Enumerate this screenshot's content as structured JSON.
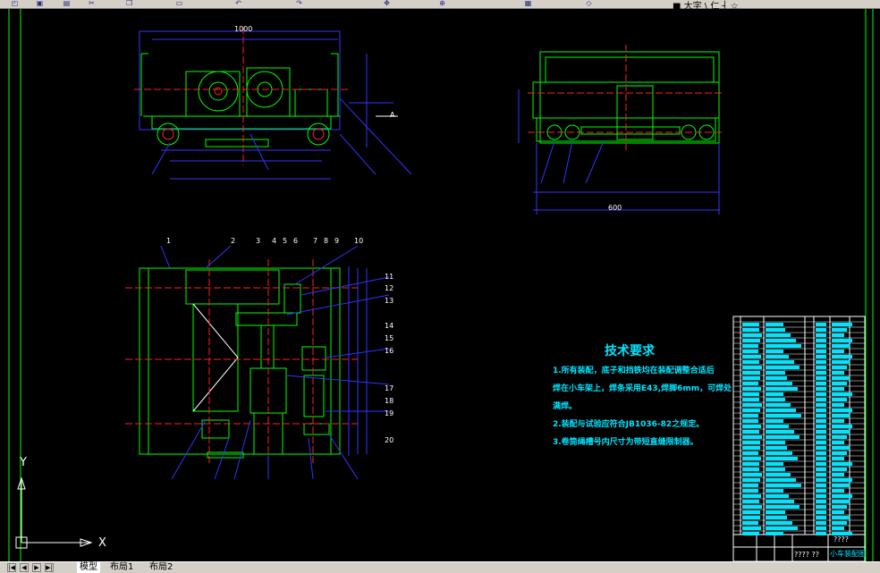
{
  "toolbar": {
    "layer_text": "■ 大字 \\ 仁 ┤ ☆",
    "icons": [
      "open-icon",
      "save-icon",
      "print-icon",
      "cut-icon",
      "copy-icon",
      "paste-icon",
      "undo-icon",
      "redo-icon",
      "pan-icon",
      "zoom-icon",
      "properties-icon",
      "layer-icon"
    ]
  },
  "drawing": {
    "tech_title": "技术要求",
    "tech_lines": [
      "1.所有装配，底子和挡铁均在装配调整合适后",
      "焊在小车架上，焊条采用E43,焊脚6mm，可焊处",
      "满焊。",
      "2.装配与试验应符合JB1036-82之规定。",
      "3.卷筒绳槽号内尺寸为带短直缝限制器。"
    ],
    "title_block": {
      "name": "小车装配图",
      "code": "????",
      "bottom_code": "???? ??"
    },
    "dim_label_plan": "600",
    "dim_label_top": "1000",
    "section_label": "A",
    "part_numbers_top": [
      "1",
      "2",
      "3",
      "4",
      "5",
      "6",
      "7",
      "8",
      "9",
      "10"
    ],
    "part_numbers_right": [
      "11",
      "12",
      "13",
      "14",
      "15",
      "16",
      "17",
      "18",
      "19",
      "20"
    ]
  },
  "ucs": {
    "x_label": "X",
    "y_label": "Y"
  },
  "statusbar": {
    "tabs": [
      "模型",
      "布局1",
      "布局2"
    ],
    "active_tab": 0
  },
  "colors": {
    "background": "#000000",
    "green": "#00ff00",
    "cyan": "#00e5ff",
    "blue": "#3333ff",
    "red": "#ff2020",
    "white": "#ffffff",
    "magenta": "#ff00ff"
  }
}
